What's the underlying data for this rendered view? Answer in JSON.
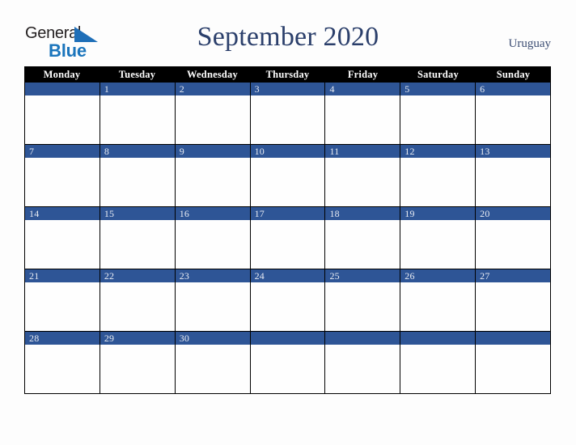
{
  "brand": {
    "word_one": "General",
    "word_two": "Blue",
    "color_dark": "#231f20",
    "color_blue": "#1b75bc",
    "triangle_color": "#1f6fb8"
  },
  "header": {
    "title": "September 2020",
    "country": "Uruguay",
    "title_color": "#2b3f6b",
    "country_color": "#3c4d73"
  },
  "calendar": {
    "month": "September",
    "year": "2020",
    "day_headers": [
      "Monday",
      "Tuesday",
      "Wednesday",
      "Thursday",
      "Friday",
      "Saturday",
      "Sunday"
    ],
    "header_bg": "#000000",
    "header_fg": "#ffffff",
    "date_bar_bg": "#2e5596",
    "date_bar_fg": "#e9ecf3",
    "cell_bg": "#ffffff",
    "grid_line": "#000000",
    "weeks": [
      {
        "days": [
          {
            "num": ""
          },
          {
            "num": "1"
          },
          {
            "num": "2"
          },
          {
            "num": "3"
          },
          {
            "num": "4"
          },
          {
            "num": "5"
          },
          {
            "num": "6"
          }
        ]
      },
      {
        "days": [
          {
            "num": "7"
          },
          {
            "num": "8"
          },
          {
            "num": "9"
          },
          {
            "num": "10"
          },
          {
            "num": "11"
          },
          {
            "num": "12"
          },
          {
            "num": "13"
          }
        ]
      },
      {
        "days": [
          {
            "num": "14"
          },
          {
            "num": "15"
          },
          {
            "num": "16"
          },
          {
            "num": "17"
          },
          {
            "num": "18"
          },
          {
            "num": "19"
          },
          {
            "num": "20"
          }
        ]
      },
      {
        "days": [
          {
            "num": "21"
          },
          {
            "num": "22"
          },
          {
            "num": "23"
          },
          {
            "num": "24"
          },
          {
            "num": "25"
          },
          {
            "num": "26"
          },
          {
            "num": "27"
          }
        ]
      },
      {
        "days": [
          {
            "num": "28"
          },
          {
            "num": "29"
          },
          {
            "num": "30"
          },
          {
            "num": ""
          },
          {
            "num": ""
          },
          {
            "num": ""
          },
          {
            "num": ""
          }
        ]
      }
    ]
  }
}
